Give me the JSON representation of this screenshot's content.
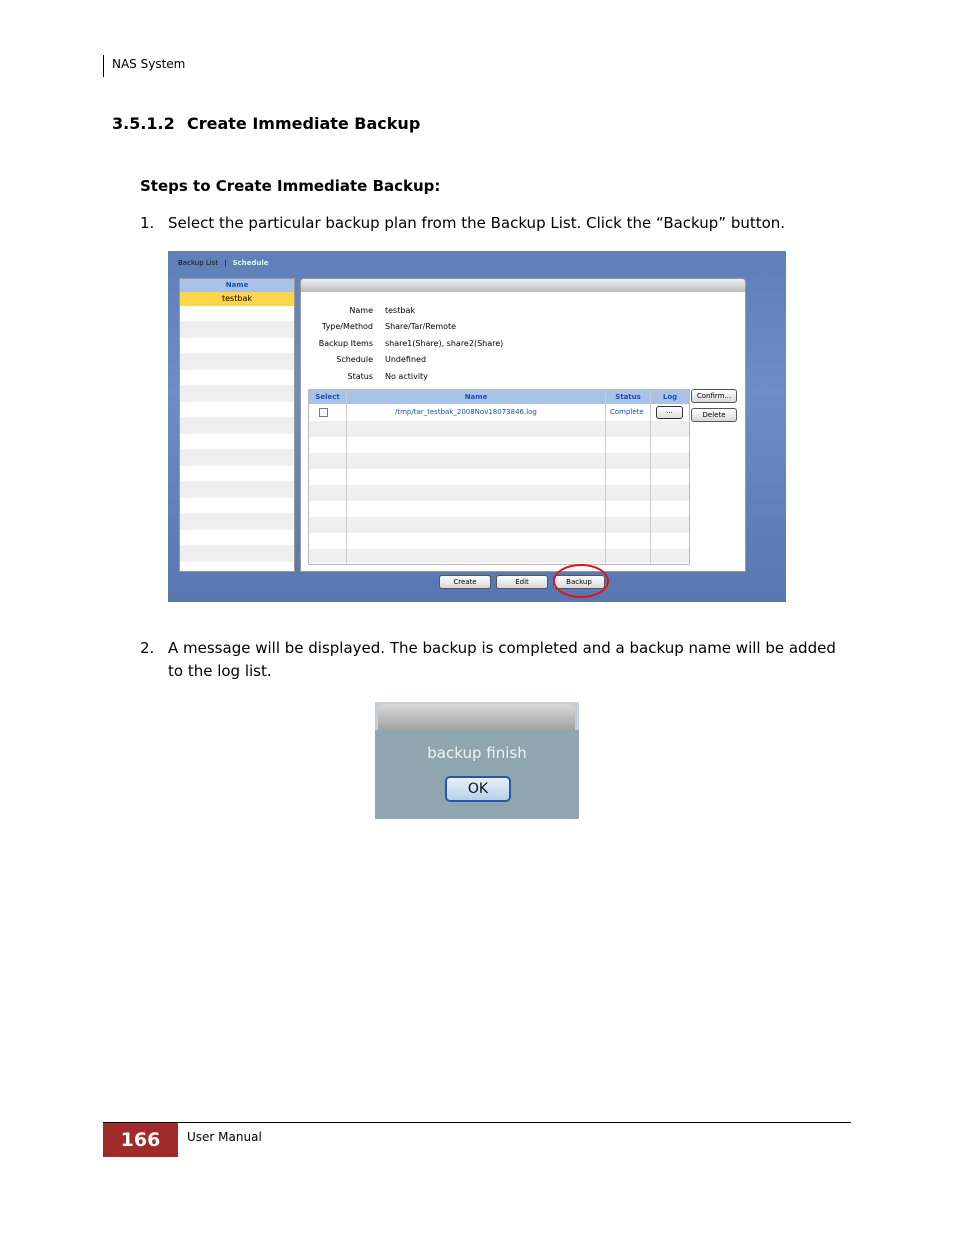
{
  "header": {
    "running_title": "NAS System"
  },
  "section": {
    "number": "3.5.1.2",
    "title": "Create Immediate Backup"
  },
  "steps_heading": "Steps to Create Immediate Backup:",
  "steps": [
    {
      "num": "1.",
      "text": "Select the particular backup plan from the Backup List. Click the “Backup” button."
    },
    {
      "num": "2.",
      "text": "A message will be displayed. The backup is completed and a backup name will be added to the log list."
    }
  ],
  "screenshot1": {
    "tabs": {
      "backup_list": "Backup List",
      "separator": "|",
      "schedule": "Schedule"
    },
    "list": {
      "header": "Name",
      "selected": "testbak"
    },
    "details": [
      {
        "key": "Name",
        "value": "testbak"
      },
      {
        "key": "Type/Method",
        "value": "Share/Tar/Remote"
      },
      {
        "key": "Backup Items",
        "value": "share1(Share), share2(Share)"
      },
      {
        "key": "Schedule",
        "value": "Undefined"
      },
      {
        "key": "Status",
        "value": "No activity"
      }
    ],
    "log_table": {
      "columns": [
        "Select",
        "Name",
        "Status",
        "Log"
      ],
      "row": {
        "name": "/tmp/tar_testbak_2008Nov18073846.log",
        "status": "Complete",
        "log_button": "..."
      }
    },
    "side_buttons": {
      "confirm": "Confirm...",
      "delete": "Delete"
    },
    "bottom_buttons": {
      "create": "Create",
      "edit": "Edit",
      "backup": "Backup"
    },
    "highlight_color": "#e0131b"
  },
  "screenshot2": {
    "message": "backup finish",
    "ok": "OK"
  },
  "footer": {
    "page_number": "166",
    "label": "User Manual",
    "accent": "#a12a2a"
  }
}
